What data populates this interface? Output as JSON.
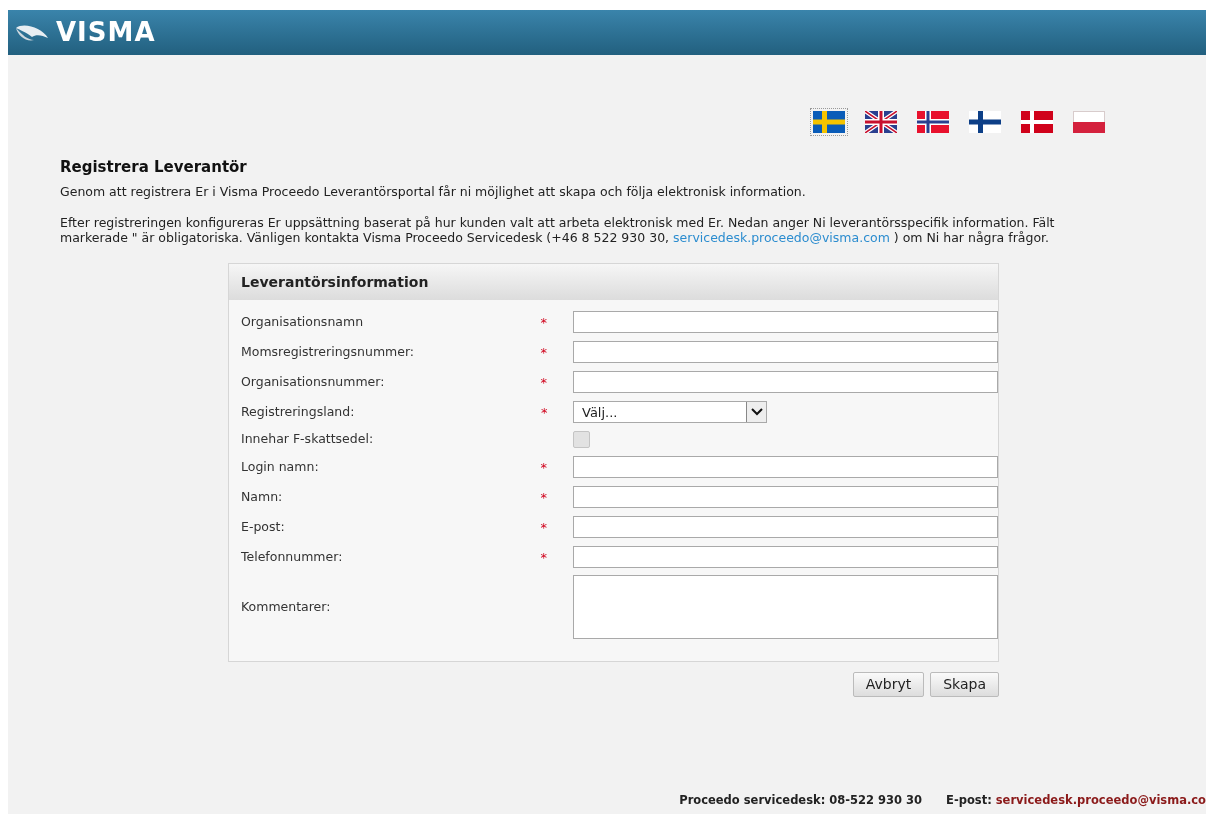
{
  "header": {
    "logo": "VISMA"
  },
  "languages": [
    {
      "kind": "se",
      "selected": true
    },
    {
      "kind": "gb",
      "selected": false
    },
    {
      "kind": "no",
      "selected": false
    },
    {
      "kind": "fi",
      "selected": false
    },
    {
      "kind": "dk",
      "selected": false
    },
    {
      "kind": "pl",
      "selected": false
    }
  ],
  "title": "Registrera Leverantör",
  "intro": "Genom att registrera Er i Visma Proceedo Leverantörsportal får ni möjlighet att skapa och följa elektronisk information.",
  "info": {
    "before": "Efter registreringen konfigureras Er uppsättning baserat på hur kunden valt att arbeta elektronisk med Er. Nedan anger Ni leverantörsspecifik information. Fält markerade \" är obligatoriska. Vänligen kontakta Visma Proceedo Servicedesk (+46 8 522 930 30,",
    "link": "servicedesk.proceedo@visma.com",
    "after": ") om Ni har några frågor."
  },
  "form": {
    "title": "Leverantörsinformation",
    "fields": [
      {
        "label": "Organisationsnamn",
        "kind": "text",
        "required": true
      },
      {
        "label": "Momsregistreringsnummer:",
        "kind": "text",
        "required": true
      },
      {
        "label": "Organisationsnummer:",
        "kind": "text",
        "required": true
      },
      {
        "label": "Registreringsland:",
        "kind": "select",
        "required": true,
        "value": "Välj..."
      },
      {
        "label": "Innehar F-skattsedel:",
        "kind": "checkbox",
        "required": false,
        "checked": false,
        "disabled": true
      },
      {
        "label": "Login namn:",
        "kind": "text",
        "required": true
      },
      {
        "label": "Namn:",
        "kind": "text",
        "required": true
      },
      {
        "label": "E-post:",
        "kind": "text",
        "required": true
      },
      {
        "label": "Telefonnummer:",
        "kind": "text",
        "required": true
      },
      {
        "label": "Kommentarer:",
        "kind": "textarea",
        "required": false
      }
    ],
    "required_mark": "*"
  },
  "buttons": [
    "Avbryt",
    "Skapa"
  ],
  "footer": {
    "phone": "Proceedo servicedesk: 08-522 930 30",
    "email_label": "E-post:",
    "email": "servicedesk.proceedo@visma.co"
  }
}
